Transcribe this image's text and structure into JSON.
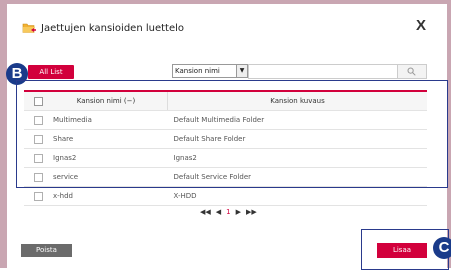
{
  "dialog": {
    "title": "Jaettujen kansioiden luettelo",
    "close_label": "X"
  },
  "toolbar": {
    "all_list_label": "All List",
    "select_value": "Kansion nimi",
    "search_placeholder": "",
    "badge_b": "B",
    "badge_c": "C"
  },
  "table": {
    "headers": [
      "Kansion nimi (−)",
      "Kansion kuvaus"
    ],
    "rows": [
      {
        "name": "Multimedia",
        "desc": "Default Multimedia Folder"
      },
      {
        "name": "Share",
        "desc": "Default Share Folder"
      },
      {
        "name": "Ignas2",
        "desc": "Ignas2"
      },
      {
        "name": "service",
        "desc": "Default Service Folder"
      },
      {
        "name": "x-hdd",
        "desc": "X-HDD"
      }
    ]
  },
  "pagination": {
    "first": "◀◀",
    "prev": "◀",
    "page": "1",
    "next": "▶",
    "last": "▶▶"
  },
  "actions": {
    "delete_label": "Poista",
    "add_label": "Lisaa"
  },
  "colors": {
    "accent": "#d2003c",
    "badge": "#1a3b8a",
    "frame": "#c9a6b2"
  }
}
